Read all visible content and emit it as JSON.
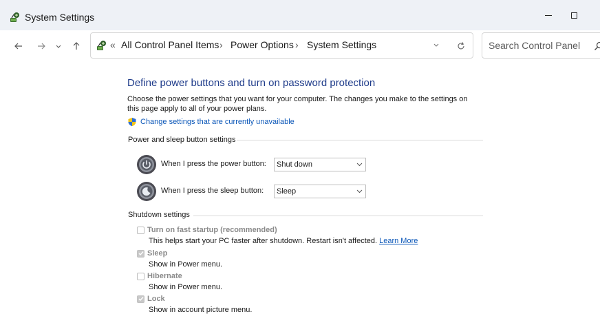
{
  "window": {
    "title": "System Settings",
    "app_icon": "power-options-icon",
    "controls": [
      "minimize-icon",
      "maximize-icon"
    ]
  },
  "nav": {
    "back": "back-arrow-icon",
    "forward": "forward-arrow-icon",
    "recent": "recent-locations-chevron-icon",
    "up": "up-arrow-icon",
    "chevron": "«",
    "breadcrumb": [
      "All Control Panel Items",
      "Power Options",
      "System Settings"
    ],
    "separator": "›",
    "refresh": "refresh-icon"
  },
  "search": {
    "placeholder": "Search Control Panel",
    "icon": "search-icon"
  },
  "page": {
    "heading": "Define power buttons and turn on password protection",
    "description": "Choose the power settings that you want for your computer. The changes you make to the settings on this page apply to all of your power plans.",
    "change_link": "Change settings that are currently unavailable",
    "shield_icon": "uac-shield-icon"
  },
  "power_sleep_section": {
    "title": "Power and sleep button settings",
    "power_label": "When I press the power button:",
    "power_value": "Shut down",
    "sleep_label": "When I press the sleep button:",
    "sleep_value": "Sleep"
  },
  "shutdown_section": {
    "title": "Shutdown settings",
    "options": [
      {
        "label": "Turn on fast startup (recommended)",
        "desc": "This helps start your PC faster after shutdown. Restart isn't affected.",
        "link": "Learn More",
        "checked": false
      },
      {
        "label": "Sleep",
        "desc": "Show in Power menu.",
        "checked": true
      },
      {
        "label": "Hibernate",
        "desc": "Show in Power menu.",
        "checked": false
      },
      {
        "label": "Lock",
        "desc": "Show in account picture menu.",
        "checked": true
      }
    ]
  },
  "colors": {
    "heading": "#1e3b8a",
    "link": "#0a56b8",
    "titlebar": "#eef1f6",
    "disabled_text": "#8a8a8a"
  }
}
